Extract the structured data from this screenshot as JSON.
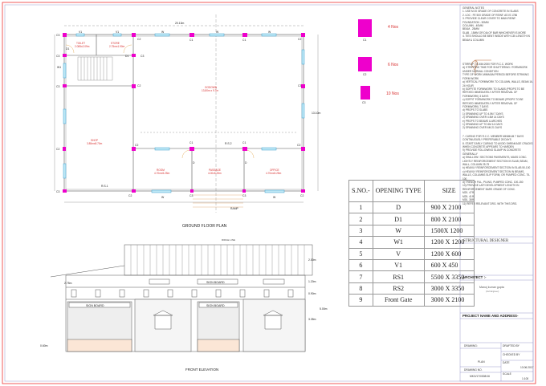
{
  "plan": {
    "title": "GROUND FLOOR PLAN",
    "overall_width": "20.13m",
    "overall_depth": "13.10m",
    "rooms": [
      {
        "name": "TOILET",
        "size": "2.085x2.09m"
      },
      {
        "name": "STORE",
        "size": "2.75mx1.90m"
      },
      {
        "name": "GODOWN",
        "size": "13.80m x 9.7m"
      },
      {
        "name": "SHOP",
        "size": "3.85mx8.70m"
      },
      {
        "name": "ROOM",
        "size": "4.70mx5.25m"
      },
      {
        "name": "PASSAGE",
        "size": "4.00x5.25m"
      },
      {
        "name": "OFFICE",
        "size": "4.70mx5.25m"
      }
    ],
    "column_labels": [
      "C1",
      "C2",
      "C3"
    ],
    "openings": {
      "d": "D",
      "d1": "D1",
      "w": "W",
      "w1": "W1",
      "v": "V",
      "v1": "V1",
      "rs1": "R.S.1",
      "rs2": "R.S.2"
    },
    "ramp_label": "RAMP"
  },
  "columns": [
    {
      "label": "C1",
      "count": "4 Nos"
    },
    {
      "label": "C2",
      "count": "6 Nos"
    },
    {
      "label": "C3",
      "count": "10 Nos"
    }
  ],
  "opening_table": {
    "headers": [
      "S.NO.-",
      "OPENING TYPE",
      "SIZE"
    ],
    "rows": [
      [
        "1",
        "D",
        "900 X 2100"
      ],
      [
        "2",
        "D1",
        "800 X 2100"
      ],
      [
        "3",
        "W",
        "1500X 1200"
      ],
      [
        "4",
        "W1",
        "1200 X 1200"
      ],
      [
        "5",
        "V",
        "1200 X 600"
      ],
      [
        "6",
        "V1",
        "600 X 450"
      ],
      [
        "7",
        "RS1",
        "5500 X 3350"
      ],
      [
        "8",
        "RS2",
        "3000 X 3350"
      ],
      [
        "9",
        "Front Gate",
        "3000 X 2100"
      ]
    ]
  },
  "elevation": {
    "title": "FRONT ELEVATION",
    "ridge_label": "RIDGE LINE",
    "sign_board": "SIGN BOARD",
    "dims": [
      "2.00m",
      "1.20m",
      "0.90m",
      "3.35m",
      "5.00m",
      "0.60m",
      "2.75m"
    ]
  },
  "title_block": {
    "notes_title": "GENERAL NOTES",
    "notes": [
      "1. USE M 20 GRADE OF CONCRETE IN SLABS",
      "2. LDC : FE 500 GRADE OF REINF. AS IS 1786",
      "3. PROVIDE CLEAR COVER TO MAIN REINF.",
      "FOUNDATION - 50MM",
      "COLUMN - 40MM",
      "BEAM - 25MM",
      "SLAB - 15MM OR DIA OF BAR WHICHEVER IS MORE",
      "4. TIES SHOULD BE BENT INSIDE WITH 135 LENGTH IN BEAM & COLUMN",
      "STIRRUP - IS 456:2000 FOR R.C.C. WORK",
      "A) STRIPPING TIME FOR SHUTTERING / FORMWORK UNDER NORMAL CONDITION",
      "TYPE OF WORK                 MINIMUM PERIOD BEFORE STRIKING FORM WORK",
      "a) VERTICAL FORMWORK TO COLUMN, WALLS, BEAM       16-24 HOUR",
      "b) SOFFITE FORMWORK TO SLABS (PROPS TO BE REFIXED IMMEDIATELY AFTER REMOVAL OF FORMWORK)   3 DAYS",
      "c) SOFFIT FORMWORK TO BEAMS (PROPS TO BE REFIXED IMMEDIATELY AFTER REMOVAL OF FORMWORK)   7 DAYS",
      "d) PROPS TO SLABS",
      "1) SPANNING UP TO 4.5M      7 DAYS",
      "2) SPANNING OVER 4.5M      14 DAYS",
      "e) PROPS TO BEAMS & ARCHES",
      "1) SPANNING UP TO 6M       14 DAYS",
      "2) SPANNING OVER 6M       21 DAYS",
      "7. CURING FOR R.C.C. MEMBER MINIMUM   7 DAYS",
      "CONTINUOUSLY PREFERABLE    28 DAYS",
      "8. START EARLY CURING TO AVOID SHRINKAGE CRACKS WHEN CONCRETE APPEARS TO HARDEN",
      "9) PROVIDE FOLLOWING SLUMP IN CONCRETE GENERALLY",
      "a) SHALLOW / SECTIONS PAVEMENTS, MASS CONC. LIGHTLY REINFORCEMENT SECTION IN SLAB, BEAM, WALL, COLUMN   25-75",
      "b) HEAVILY REINFORCEMENT SECTION IN SLAB   50-100",
      "c) HEAVILY REINFORCEMENT SECTION IN BEAMS, WALLS, COLUMNS SLIP FORM, OR PUMPED CONC.   75-100",
      "d) TRENCH FILL, PILING, PUMPED CONC.   100-150",
      "10) PROVIDE LAP/ DEVELOPMENT LENGTH IN REINFORCEMENT BARS GRADE OF CONC.",
      "M20- 47Φ",
      "M25- 41Φ",
      "M30- 38Φ",
      "11) REFER RELEVANT DRG. WITH THIS DRG."
    ],
    "structural_designer": "STRUCTURAL DESIGNER",
    "architect_label": "ARCHITECT :-",
    "architect_name": "Manoj kumar gupta",
    "architect_sub": "(Civil Engineer)",
    "project_label": "PROJECT NAME AND ADDRESS-",
    "drawing_label": "DRAWING:",
    "drafted_by": "DRAFTED BY",
    "checked_by": "CHECKED BY",
    "drawing_name": "PLAN",
    "date_label": "DATE",
    "date": "13.06.2017",
    "drawing_no_label": "DRAWING NO.",
    "drawing_no": "MKG/17/0308/16",
    "scale_label": "SCALE",
    "scale": "1:100"
  }
}
